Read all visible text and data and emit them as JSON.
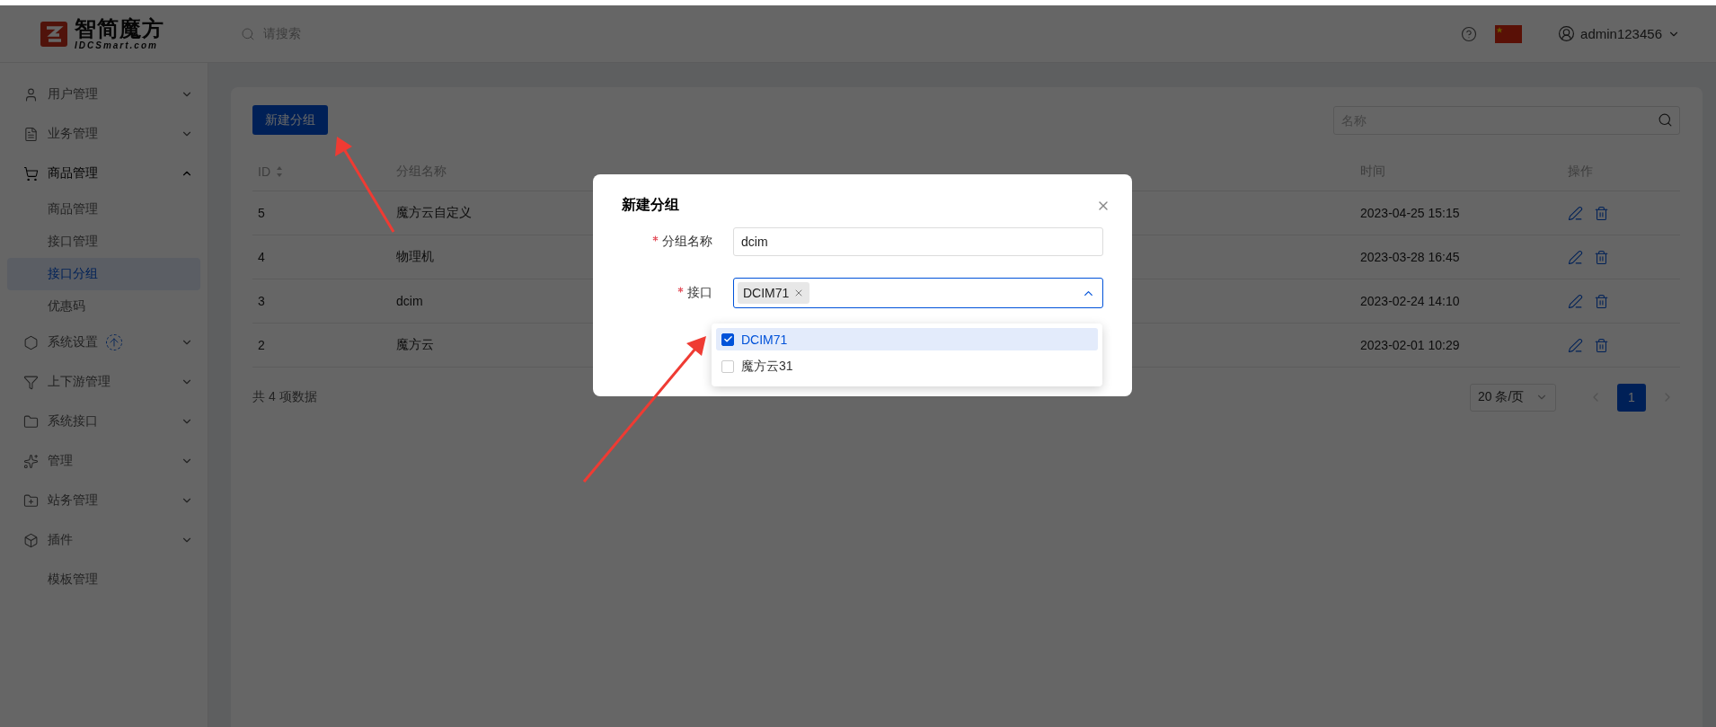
{
  "header": {
    "logo_text": "智简魔方",
    "logo_subtext": "IDCSmart.com",
    "search_placeholder": "请搜索",
    "username": "admin123456"
  },
  "sidebar": {
    "items": [
      {
        "label": "用户管理",
        "kind": "user",
        "expanded": false
      },
      {
        "label": "业务管理",
        "kind": "orders",
        "expanded": false
      },
      {
        "label": "商品管理",
        "kind": "cart",
        "expanded": true,
        "children": [
          {
            "label": "商品管理",
            "selected": false
          },
          {
            "label": "接口管理",
            "selected": false
          },
          {
            "label": "接口分组",
            "selected": true
          },
          {
            "label": "优惠码",
            "selected": false
          }
        ]
      },
      {
        "label": "系统设置",
        "kind": "settings",
        "expanded": false,
        "has_update": true
      },
      {
        "label": "上下游管理",
        "kind": "filter",
        "expanded": false
      },
      {
        "label": "系统接口",
        "kind": "folder",
        "expanded": false
      },
      {
        "label": "管理",
        "kind": "spark",
        "expanded": false
      },
      {
        "label": "站务管理",
        "kind": "folder-add",
        "expanded": false
      },
      {
        "label": "插件",
        "kind": "box",
        "expanded": false
      },
      {
        "label": "模板管理",
        "kind": "plain",
        "expanded": false
      }
    ]
  },
  "toolbar": {
    "new_button": "新建分组",
    "search_placeholder": "名称"
  },
  "table": {
    "columns": [
      {
        "label": "ID",
        "sortable": true
      },
      {
        "label": "分组名称"
      },
      {
        "label": "时间"
      },
      {
        "label": "操作"
      }
    ],
    "rows": [
      {
        "id": "5",
        "name": "魔方云自定义",
        "time": "2023-04-25 15:15"
      },
      {
        "id": "4",
        "name": "物理机",
        "time": "2023-03-28 16:45"
      },
      {
        "id": "3",
        "name": "dcim",
        "time": "2023-02-24 14:10"
      },
      {
        "id": "2",
        "name": "魔方云",
        "time": "2023-02-01 10:29"
      }
    ]
  },
  "footer": {
    "total": "共 4 项数据",
    "page_size": "20 条/页",
    "pages": [
      {
        "label": "1",
        "selected": true
      }
    ]
  },
  "modal": {
    "title": "新建分组",
    "fields": [
      {
        "label": "分组名称",
        "required": true,
        "kind": "text",
        "value": "dcim"
      },
      {
        "label": "接口",
        "required": true,
        "kind": "multiselect",
        "tags": [
          "DCIM71"
        ],
        "open": true
      }
    ],
    "options": [
      {
        "label": "DCIM71",
        "checked": true
      },
      {
        "label": "魔方云31",
        "checked": false
      }
    ]
  }
}
